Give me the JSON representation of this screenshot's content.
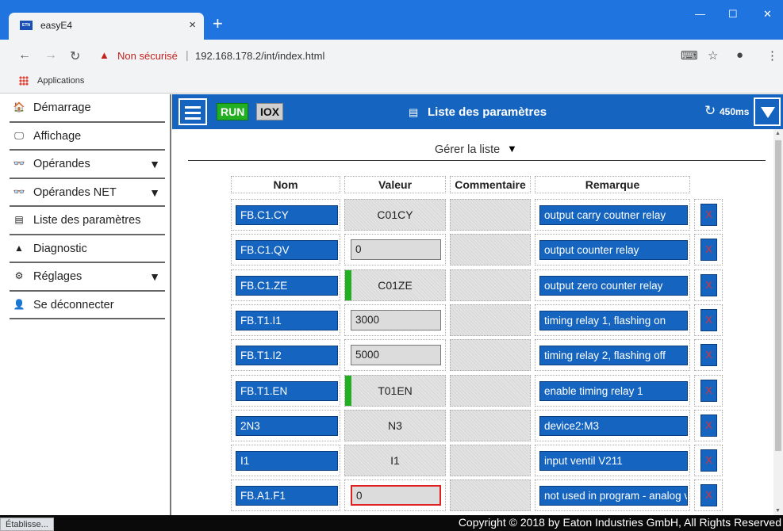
{
  "browser": {
    "tab_title": "easyE4",
    "favicon_text": "ETN",
    "new_tab": "+",
    "minimize": "—",
    "maximize": "☐",
    "close": "✕",
    "tab_close": "×",
    "security_label": "Non sécurisé",
    "url": "192.168.178.2/int/index.html",
    "bookmarks": {
      "apps_label": "Applications"
    },
    "status_text": "Établisse..."
  },
  "sidebar": {
    "items": [
      {
        "label": "Démarrage",
        "icon": "home-icon",
        "glyph": "🏠",
        "arrow": ""
      },
      {
        "label": "Affichage",
        "icon": "monitor-icon",
        "glyph": "🖵",
        "arrow": ""
      },
      {
        "label": "Opérandes",
        "icon": "glasses-icon",
        "glyph": "👓",
        "arrow": "▼"
      },
      {
        "label": "Opérandes NET",
        "icon": "glasses-icon",
        "glyph": "👓",
        "arrow": "▼"
      },
      {
        "label": "Liste des paramètres",
        "icon": "list-icon",
        "glyph": "▤",
        "arrow": ""
      },
      {
        "label": "Diagnostic",
        "icon": "warning-icon",
        "glyph": "▲",
        "arrow": ""
      },
      {
        "label": "Réglages",
        "icon": "gear-icon",
        "glyph": "⚙",
        "arrow": "▼"
      },
      {
        "label": "Se déconnecter",
        "icon": "user-icon",
        "glyph": "👤",
        "arrow": ""
      }
    ]
  },
  "header": {
    "run_label": "RUN",
    "iox_label": "IOX",
    "title": "Liste des paramètres",
    "refresh_label": "450ms",
    "colors": {
      "header_bg": "#1565c0",
      "run_bg": "#22b022"
    }
  },
  "content": {
    "manage_label": "Gérer la liste",
    "manage_arrow": "▼",
    "columns": {
      "name": "Nom",
      "value": "Valeur",
      "comment": "Commentaire",
      "remark": "Remarque"
    },
    "rows": [
      {
        "name": "FB.C1.CY",
        "value": "C01CY",
        "kind": "static",
        "green": false,
        "error": false,
        "comment": "",
        "remark": "output carry coutner relay",
        "delete": "X"
      },
      {
        "name": "FB.C1.QV",
        "value": "0",
        "kind": "input",
        "green": false,
        "error": false,
        "comment": "",
        "remark": "output counter relay",
        "delete": "X"
      },
      {
        "name": "FB.C1.ZE",
        "value": "C01ZE",
        "kind": "static",
        "green": true,
        "error": false,
        "comment": "",
        "remark": "output zero counter relay",
        "delete": "X"
      },
      {
        "name": "FB.T1.I1",
        "value": "3000",
        "kind": "input",
        "green": false,
        "error": false,
        "comment": "",
        "remark": "timing relay 1, flashing on",
        "delete": "X"
      },
      {
        "name": "FB.T1.I2",
        "value": "5000",
        "kind": "input",
        "green": false,
        "error": false,
        "comment": "",
        "remark": "timing relay 2, flashing off",
        "delete": "X"
      },
      {
        "name": "FB.T1.EN",
        "value": "T01EN",
        "kind": "static",
        "green": true,
        "error": false,
        "comment": "",
        "remark": "enable timing relay 1",
        "delete": "X"
      },
      {
        "name": "2N3",
        "value": "N3",
        "kind": "static",
        "green": false,
        "error": false,
        "comment": "",
        "remark": "device2:M3",
        "delete": "X"
      },
      {
        "name": "I1",
        "value": "I1",
        "kind": "static",
        "green": false,
        "error": false,
        "comment": "",
        "remark": "input ventil V211",
        "delete": "X"
      },
      {
        "name": "FB.A1.F1",
        "value": "0",
        "kind": "input",
        "green": false,
        "error": true,
        "comment": "",
        "remark": "not used in program - analog value comparator",
        "delete": "X"
      }
    ]
  },
  "footer": {
    "copyright": "Copyright © 2018 by Eaton Industries GmbH, All Rights Reserved"
  }
}
